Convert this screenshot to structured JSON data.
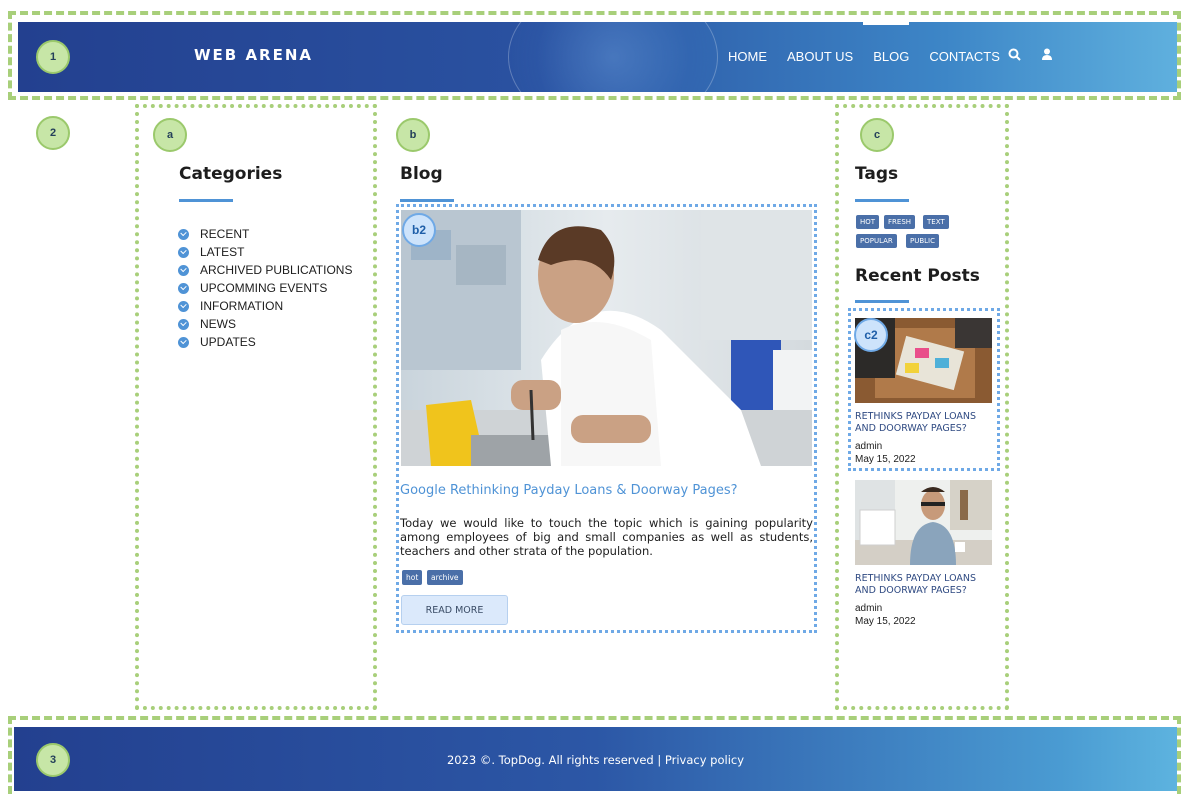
{
  "annotations": {
    "header": "1",
    "content": "2",
    "footer": "3",
    "categories_col": "a",
    "blog_col": "b",
    "blog_post": "b2",
    "sidebar_col": "c",
    "recent_post": "c2"
  },
  "header": {
    "logo": "WEB ARENA",
    "nav": [
      "HOME",
      "ABOUT US",
      "BLOG",
      "CONTACTS"
    ],
    "active_nav": "BLOG",
    "icons": [
      "search-icon",
      "user-icon"
    ]
  },
  "categories": {
    "title": "Categories",
    "items": [
      "RECENT",
      "LATEST",
      "ARCHIVED PUBLICATIONS",
      "UPCOMMING EVENTS",
      "INFORMATION",
      "NEWS",
      "UPDATES"
    ]
  },
  "blog": {
    "title": "Blog",
    "post": {
      "title": "Google Rethinking Payday Loans & Doorway Pages?",
      "body": "Today we would like to touch the topic which is gaining popularity among employees of big and small companies as well as students, teachers and other strata of the population.",
      "tags": [
        "hot",
        "archive"
      ],
      "read_more": "READ MORE"
    }
  },
  "sidebar": {
    "tags_title": "Tags",
    "tags": [
      "HOT",
      "FRESH",
      "TEXT",
      "POPULAR",
      "PUBLIC"
    ],
    "recent_title": "Recent Posts",
    "recent_posts": [
      {
        "title": "RETHINKS PAYDAY LOANS AND DOORWAY PAGES?",
        "author": "admin",
        "date": "May 15, 2022"
      },
      {
        "title": "RETHINKS PAYDAY LOANS AND DOORWAY PAGES?",
        "author": "admin",
        "date": "May 15, 2022"
      }
    ]
  },
  "footer": {
    "text": "2023 ©. TopDog. All rights reserved | Privacy policy"
  },
  "colors": {
    "accent": "#4f93d6",
    "header_start": "#23408f",
    "header_end": "#5fb0de",
    "annotation_green": "#a8cf7a",
    "annotation_blue": "#6fa9e6"
  }
}
